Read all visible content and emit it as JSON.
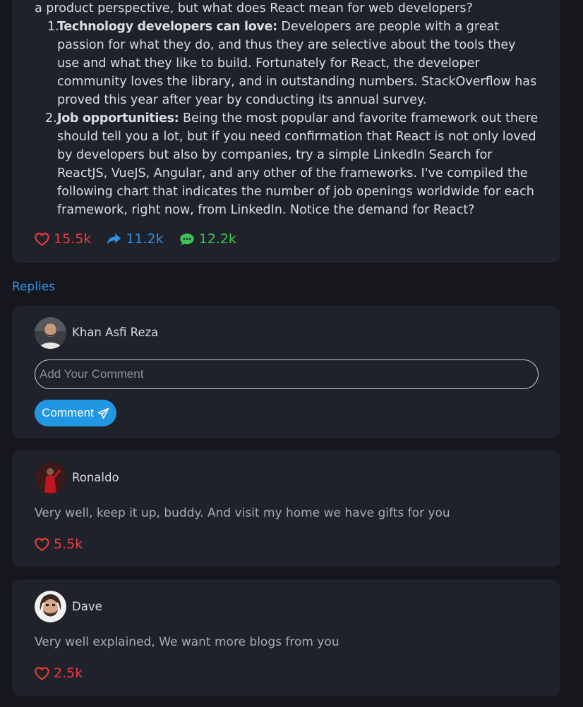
{
  "post": {
    "lead": "a product perspective, but what does React mean for web developers?",
    "points": [
      {
        "num": "1.",
        "title": "Technology developers can love:",
        "text": " Developers are people with a great passion for what they do, and thus they are selective about the tools they use and what they like to build. Fortunately for React, the developer community loves the library, and in outstanding numbers. StackOverflow has proved this year after year by conducting its annual survey."
      },
      {
        "num": "2.",
        "title": "Job opportunities:",
        "text": " Being the most popular and favorite framework out there should tell you a lot, but if you need confirmation that React is not only loved by developers but also by companies, try a simple LinkedIn Search for ReactJS, VueJS, Angular, and any other of the frameworks. I've compiled the following chart that indicates the number of job openings worldwide for each framework, right now, from LinkedIn. Notice the demand for React?"
      }
    ],
    "stats": {
      "likes": "15.5k",
      "shares": "11.2k",
      "comments": "12.2k"
    }
  },
  "replies_label": "Replies",
  "composer": {
    "user_name": "Khan Asfi Reza",
    "placeholder": "Add Your Comment",
    "button_label": "Comment"
  },
  "replies": [
    {
      "user_name": "Ronaldo",
      "text": "Very well, keep it up, buddy. And visit my home we have gifts for you",
      "likes": "5.5k"
    },
    {
      "user_name": "Dave",
      "text": "Very well explained, We want more blogs from you",
      "likes": "2.5k"
    }
  ],
  "colors": {
    "like": "#ef3b3b",
    "share": "#2f8fe3",
    "comment": "#3ec256",
    "accent_button": "#2196e3"
  }
}
